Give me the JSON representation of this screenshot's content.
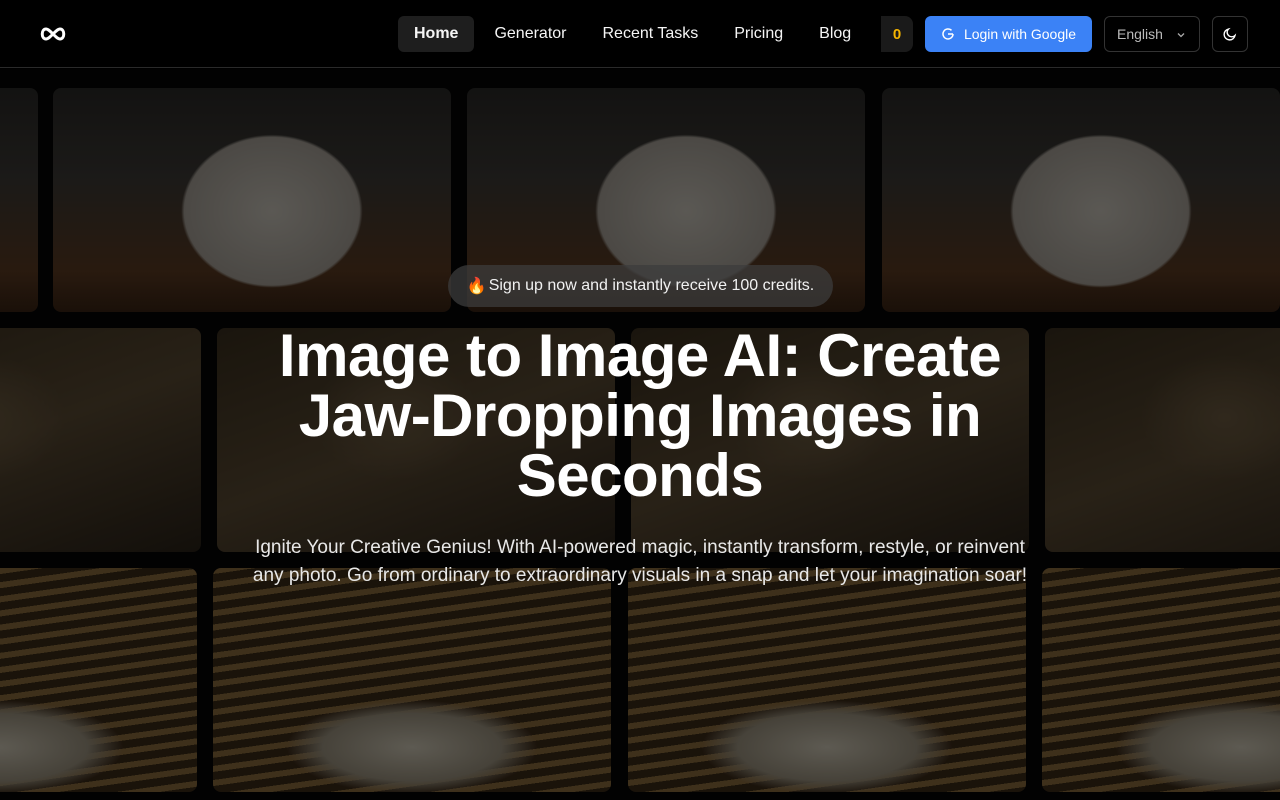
{
  "header": {
    "logo_icon": "infinity-icon",
    "nav": [
      {
        "label": "Home",
        "active": true
      },
      {
        "label": "Generator",
        "active": false
      },
      {
        "label": "Recent Tasks",
        "active": false
      },
      {
        "label": "Pricing",
        "active": false
      },
      {
        "label": "Blog",
        "active": false
      }
    ],
    "credits": "0",
    "login_label": "Login with Google",
    "language": "English",
    "theme_icon": "moon-icon"
  },
  "hero": {
    "promo_icon": "fire-icon",
    "promo_text": "Sign up now and instantly receive 100 credits.",
    "title": "Image to Image AI: Create Jaw-Dropping Images in Seconds",
    "subtitle": "Ignite Your Creative Genius! With AI-powered magic, instantly transform, restyle, or reinvent any photo. Go from ordinary to extraordinary visuals in a snap and let your imagination soar!"
  },
  "colors": {
    "accent": "#3b82f6",
    "credits": "#f5b400",
    "background": "#000000"
  }
}
